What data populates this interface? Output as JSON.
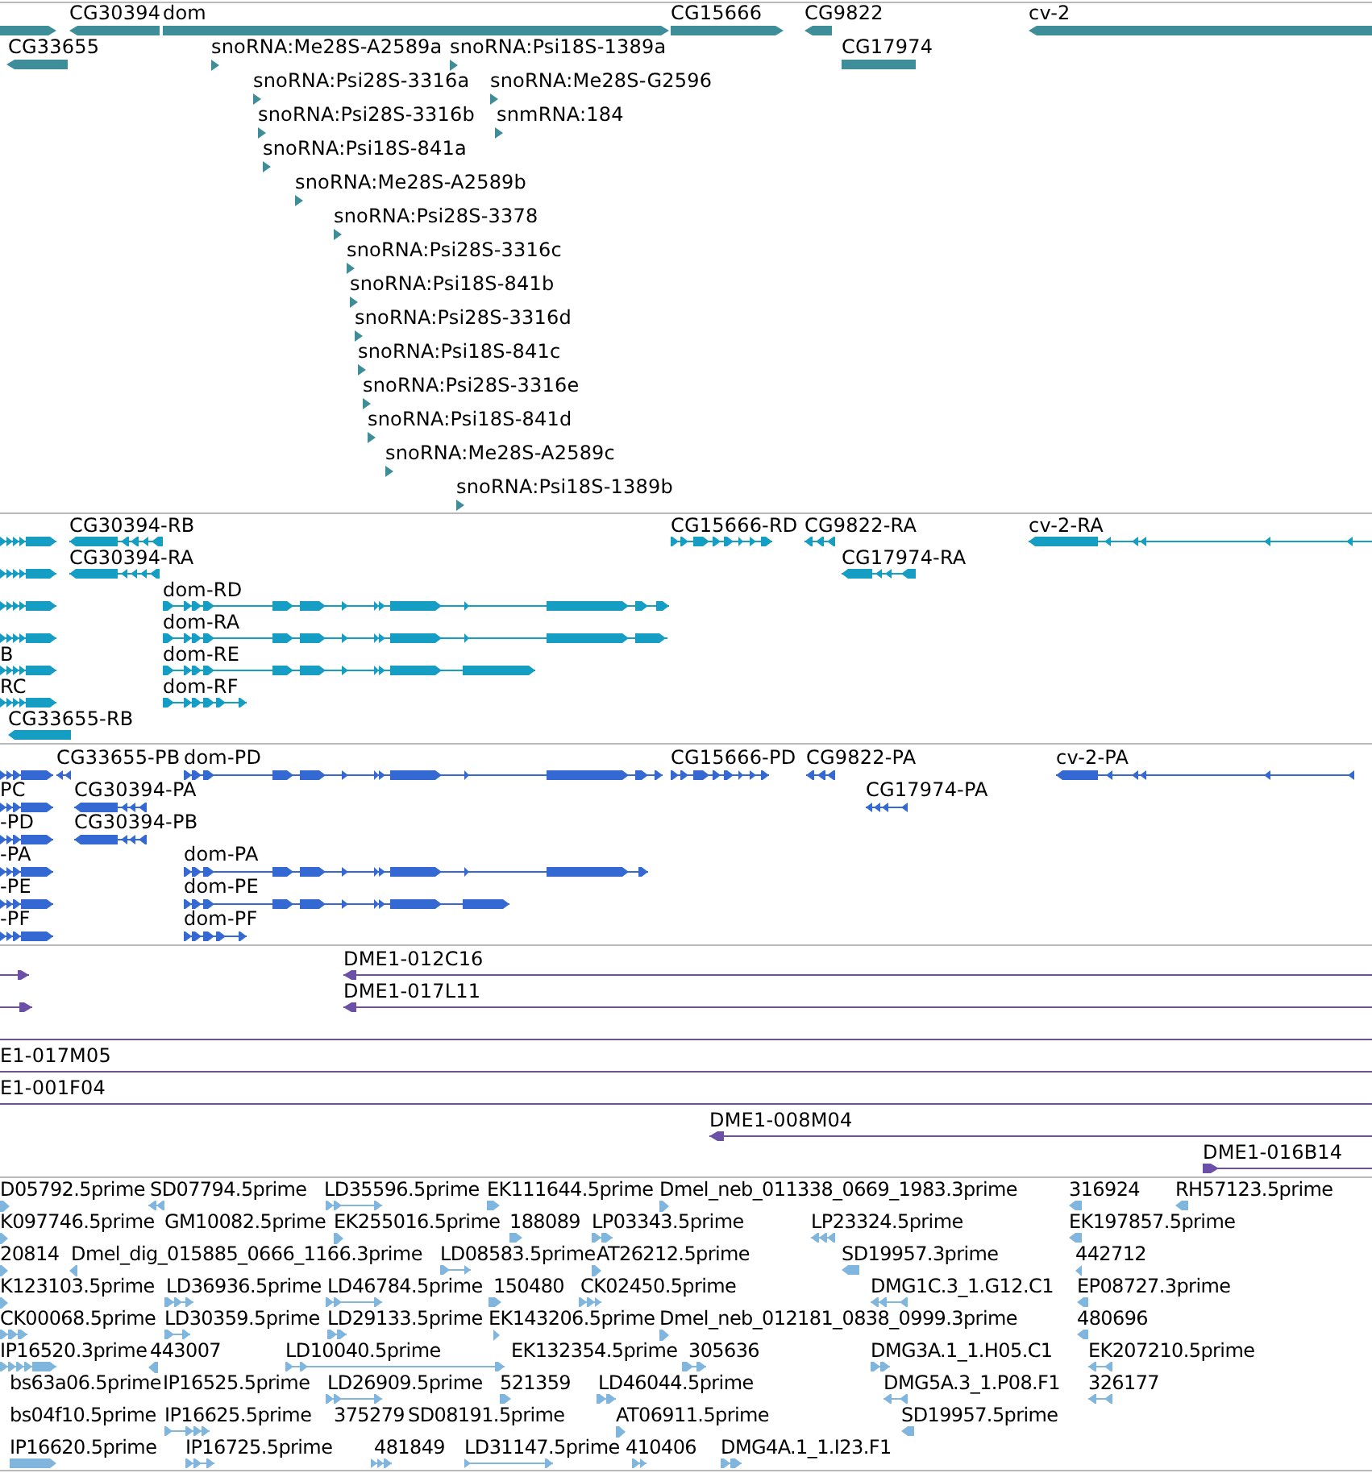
{
  "tracks": [
    {
      "kind": "gene",
      "rows": [
        {
          "features": [
            {
              "kind": "arrow",
              "reverse": false
            },
            {
              "label": "CG30394",
              "kind": "arrow",
              "reverse": true
            },
            {
              "label": "dom",
              "kind": "arrow",
              "reverse": false
            },
            {
              "label": "CG15666",
              "kind": "arrow",
              "reverse": false
            },
            {
              "label": "CG9822",
              "kind": "arrow",
              "reverse": true
            },
            {
              "label": "cv-2",
              "kind": "arrow",
              "reverse": true
            }
          ]
        },
        {
          "features": [
            {
              "label": "CG33655",
              "kind": "arrow",
              "reverse": true
            },
            {
              "label": "snoRNA:Me28S-A2589a",
              "kind": "arrow",
              "reverse": false
            },
            {
              "label": "snoRNA:Psi18S-1389a",
              "kind": "arrow",
              "reverse": false
            },
            {
              "label": "CG17974",
              "kind": "plain"
            }
          ]
        },
        {
          "features": [
            {
              "label": "snoRNA:Psi28S-3316a",
              "kind": "arrow",
              "reverse": false
            },
            {
              "label": "snoRNA:Me28S-G2596",
              "kind": "arrow",
              "reverse": false
            }
          ]
        },
        {
          "features": [
            {
              "label": "snoRNA:Psi28S-3316b",
              "kind": "arrow",
              "reverse": false
            },
            {
              "label": "snmRNA:184",
              "kind": "arrow",
              "reverse": false
            }
          ]
        },
        {
          "features": [
            {
              "label": "snoRNA:Psi18S-841a",
              "kind": "arrow",
              "reverse": false
            }
          ]
        },
        {
          "features": [
            {
              "label": "snoRNA:Me28S-A2589b",
              "kind": "arrow",
              "reverse": false
            }
          ]
        },
        {
          "features": [
            {
              "label": "snoRNA:Psi28S-3378",
              "kind": "arrow",
              "reverse": false
            }
          ]
        },
        {
          "features": [
            {
              "label": "snoRNA:Psi28S-3316c",
              "kind": "arrow",
              "reverse": false
            }
          ]
        },
        {
          "features": [
            {
              "label": "snoRNA:Psi18S-841b",
              "kind": "arrow",
              "reverse": false
            }
          ]
        },
        {
          "features": [
            {
              "label": "snoRNA:Psi28S-3316d",
              "kind": "arrow",
              "reverse": false
            }
          ]
        },
        {
          "features": [
            {
              "label": "snoRNA:Psi18S-841c",
              "kind": "arrow",
              "reverse": false
            }
          ]
        },
        {
          "features": [
            {
              "label": "snoRNA:Psi28S-3316e",
              "kind": "arrow",
              "reverse": false
            }
          ]
        },
        {
          "features": [
            {
              "label": "snoRNA:Psi18S-841d",
              "kind": "arrow",
              "reverse": false
            }
          ]
        },
        {
          "features": [
            {
              "label": "snoRNA:Me28S-A2589c",
              "kind": "arrow",
              "reverse": false
            }
          ]
        },
        {
          "features": [
            {
              "label": "snoRNA:Psi18S-1389b",
              "kind": "arrow",
              "reverse": false
            }
          ]
        }
      ]
    },
    {
      "kind": "transcript",
      "rows": [
        {
          "features": [
            {
              "kind": "arrow",
              "reverse": false
            },
            {
              "label": "CG30394-RB",
              "kind": "arrow",
              "reverse": true
            },
            {
              "label": "CG15666-RD",
              "kind": "arrow",
              "reverse": false
            },
            {
              "label": "CG9822-RA",
              "kind": "arrow",
              "reverse": true
            },
            {
              "label": "cv-2-RA",
              "kind": "arrow",
              "reverse": true
            }
          ]
        },
        {
          "features": [
            {
              "kind": "arrow",
              "reverse": false
            },
            {
              "label": "CG30394-RA",
              "kind": "arrow",
              "reverse": true
            },
            {
              "label": "CG17974-RA",
              "kind": "arrow",
              "reverse": true
            }
          ]
        },
        {
          "features": [
            {
              "kind": "arrow",
              "reverse": false
            },
            {
              "label": "dom-RD",
              "kind": "arrow",
              "reverse": false
            }
          ]
        },
        {
          "features": [
            {
              "kind": "arrow",
              "reverse": false
            },
            {
              "label": "dom-RA",
              "kind": "arrow",
              "reverse": false
            }
          ]
        },
        {
          "features": [
            {
              "label": "B",
              "kind": "arrow",
              "reverse": false
            },
            {
              "label": "dom-RE",
              "kind": "arrow",
              "reverse": false
            }
          ]
        },
        {
          "features": [
            {
              "label": "RC",
              "kind": "arrow",
              "reverse": false
            },
            {
              "label": "dom-RF",
              "kind": "arrow",
              "reverse": false
            }
          ]
        },
        {
          "features": [
            {
              "label": "CG33655-RB",
              "kind": "arrow",
              "reverse": true
            }
          ]
        }
      ]
    },
    {
      "kind": "protein",
      "rows": [
        {
          "features": [
            {
              "kind": "arrow",
              "reverse": false
            },
            {
              "label": "CG33655-PB",
              "kind": "arrow",
              "reverse": true
            },
            {
              "label": "dom-PD",
              "kind": "arrow",
              "reverse": false
            },
            {
              "label": "CG15666-PD",
              "kind": "arrow",
              "reverse": false
            },
            {
              "label": "CG9822-PA",
              "kind": "arrow",
              "reverse": true
            },
            {
              "label": "cv-2-PA",
              "kind": "arrow",
              "reverse": true
            }
          ]
        },
        {
          "features": [
            {
              "label": "PC",
              "kind": "arrow",
              "reverse": false
            },
            {
              "label": "CG30394-PA",
              "kind": "arrow",
              "reverse": true
            },
            {
              "label": "CG17974-PA",
              "kind": "arrow",
              "reverse": true
            }
          ]
        },
        {
          "features": [
            {
              "label": "-PD",
              "kind": "arrow",
              "reverse": false
            },
            {
              "label": "CG30394-PB",
              "kind": "arrow",
              "reverse": true
            }
          ]
        },
        {
          "features": [
            {
              "label": "-PA",
              "kind": "arrow",
              "reverse": false
            },
            {
              "label": "dom-PA",
              "kind": "arrow",
              "reverse": false
            }
          ]
        },
        {
          "features": [
            {
              "label": "-PE",
              "kind": "arrow",
              "reverse": false
            },
            {
              "label": "dom-PE",
              "kind": "arrow",
              "reverse": false
            }
          ]
        },
        {
          "features": [
            {
              "label": "-PF",
              "kind": "arrow",
              "reverse": false
            },
            {
              "label": "dom-PF",
              "kind": "arrow",
              "reverse": false
            }
          ]
        }
      ]
    },
    {
      "kind": "clone",
      "rows": [
        {
          "features": [
            {
              "kind": "arrow",
              "reverse": false
            },
            {
              "label": "DME1-012C16",
              "kind": "arrow",
              "reverse": true
            }
          ]
        },
        {
          "features": [
            {
              "kind": "arrow",
              "reverse": false
            },
            {
              "label": "DME1-017L11",
              "kind": "arrow",
              "reverse": true
            }
          ]
        },
        {
          "features": [
            {
              "kind": "plain"
            }
          ]
        },
        {
          "features": [
            {
              "label": "E1-017M05",
              "kind": "plain"
            }
          ]
        },
        {
          "features": [
            {
              "label": "E1-001F04",
              "kind": "plain"
            }
          ]
        },
        {
          "features": [
            {
              "label": "DME1-008M04",
              "kind": "arrow",
              "reverse": true
            }
          ]
        },
        {
          "features": [
            {
              "label": "DME1-016B14",
              "kind": "arrow",
              "reverse": false
            }
          ]
        }
      ]
    },
    {
      "kind": "est",
      "rows": [
        {
          "features": [
            {
              "label": "D05792.5prime",
              "kind": "arrow",
              "reverse": false
            },
            {
              "label": "SD07794.5prime",
              "kind": "arrow",
              "reverse": true
            },
            {
              "label": "LD35596.5prime",
              "kind": "arrow",
              "reverse": false
            },
            {
              "label": "EK111644.5prime",
              "kind": "arrow",
              "reverse": false
            },
            {
              "label": "Dmel_neb_011338_0669_1983.3prime",
              "kind": "arrow",
              "reverse": false
            },
            {
              "label": "316924",
              "kind": "arrow",
              "reverse": true
            },
            {
              "label": "RH57123.5prime",
              "kind": "arrow",
              "reverse": true
            }
          ]
        },
        {
          "features": [
            {
              "label": "K097746.5prime",
              "kind": "arrow",
              "reverse": false
            },
            {
              "label": "GM10082.5prime",
              "kind": "tag"
            },
            {
              "label": "EK255016.5prime",
              "kind": "arrow",
              "reverse": false
            },
            {
              "label": "188089",
              "kind": "arrow",
              "reverse": false
            },
            {
              "label": "LP03343.5prime",
              "kind": "arrow",
              "reverse": false
            },
            {
              "label": "LP23324.5prime",
              "kind": "arrow",
              "reverse": true
            },
            {
              "label": "EK197857.5prime",
              "kind": "arrow",
              "reverse": true
            }
          ]
        },
        {
          "features": [
            {
              "label": "20814",
              "kind": "arrow",
              "reverse": false
            },
            {
              "label": "Dmel_dig_015885_0666_1166.3prime",
              "kind": "arrow",
              "reverse": true
            },
            {
              "label": "LD08583.5prime",
              "kind": "arrow",
              "reverse": false
            },
            {
              "label": "AT26212.5prime",
              "kind": "arrow",
              "reverse": false
            },
            {
              "label": "SD19957.3prime",
              "kind": "arrow",
              "reverse": true
            },
            {
              "label": "442712",
              "kind": "arrow",
              "reverse": true
            }
          ]
        },
        {
          "features": [
            {
              "label": "K123103.5prime",
              "kind": "arrow",
              "reverse": false
            },
            {
              "label": "LD36936.5prime",
              "kind": "arrow",
              "reverse": false
            },
            {
              "label": "LD46784.5prime",
              "kind": "arrow",
              "reverse": false
            },
            {
              "label": "150480",
              "kind": "arrow",
              "reverse": false
            },
            {
              "label": "CK02450.5prime",
              "kind": "arrow",
              "reverse": false
            },
            {
              "label": "DMG1C.3_1.G12.C1",
              "kind": "arrow",
              "reverse": true
            },
            {
              "label": "EP08727.3prime",
              "kind": "arrow",
              "reverse": true
            }
          ]
        },
        {
          "features": [
            {
              "label": "CK00068.5prime",
              "kind": "arrow",
              "reverse": false
            },
            {
              "label": "LD30359.5prime",
              "kind": "arrow",
              "reverse": false
            },
            {
              "label": "LD29133.5prime",
              "kind": "arrow",
              "reverse": false
            },
            {
              "label": "EK143206.5prime",
              "kind": "arrow",
              "reverse": false
            },
            {
              "label": "Dmel_neb_012181_0838_0999.3prime",
              "kind": "arrow",
              "reverse": false
            },
            {
              "label": "480696",
              "kind": "arrow",
              "reverse": true
            }
          ]
        },
        {
          "features": [
            {
              "label": "IP16520.3prime",
              "kind": "arrow",
              "reverse": false
            },
            {
              "label": "443007",
              "kind": "arrow",
              "reverse": true
            },
            {
              "label": "LD10040.5prime",
              "kind": "arrow",
              "reverse": false
            },
            {
              "label": "EK132354.5prime",
              "kind": "tag"
            },
            {
              "label": "305636",
              "kind": "arrow",
              "reverse": false
            },
            {
              "label": "DMG3A.1_1.H05.C1",
              "kind": "arrow",
              "reverse": false
            },
            {
              "label": "EK207210.5prime",
              "kind": "arrow",
              "reverse": true
            }
          ]
        },
        {
          "features": [
            {
              "label": "bs63a06.5prime",
              "kind": "tag"
            },
            {
              "label": "IP16525.5prime",
              "kind": "tag"
            },
            {
              "label": "LD26909.5prime",
              "kind": "arrow",
              "reverse": false
            },
            {
              "label": "521359",
              "kind": "arrow",
              "reverse": false
            },
            {
              "label": "LD46044.5prime",
              "kind": "arrow",
              "reverse": false
            },
            {
              "label": "DMG5A.3_1.P08.F1",
              "kind": "arrow",
              "reverse": true
            },
            {
              "label": "326177",
              "kind": "arrow",
              "reverse": true
            }
          ]
        },
        {
          "features": [
            {
              "label": "bs04f10.5prime",
              "kind": "tag"
            },
            {
              "label": "IP16625.5prime",
              "kind": "arrow",
              "reverse": false
            },
            {
              "label": "375279",
              "kind": "tag"
            },
            {
              "label": "SD08191.5prime",
              "kind": "tag"
            },
            {
              "label": "AT06911.5prime",
              "kind": "arrow",
              "reverse": false
            },
            {
              "label": "SD19957.5prime",
              "kind": "arrow",
              "reverse": true
            }
          ]
        },
        {
          "features": [
            {
              "label": "IP16620.5prime",
              "kind": "arrow",
              "reverse": false
            },
            {
              "label": "IP16725.5prime",
              "kind": "arrow",
              "reverse": false
            },
            {
              "label": "481849",
              "kind": "arrow",
              "reverse": false
            },
            {
              "label": "LD31147.5prime",
              "kind": "arrow",
              "reverse": false
            },
            {
              "label": "410406",
              "kind": "arrow",
              "reverse": false
            },
            {
              "label": "DMG4A.1_1.I23.F1",
              "kind": "arrow",
              "reverse": false
            }
          ]
        }
      ]
    }
  ]
}
